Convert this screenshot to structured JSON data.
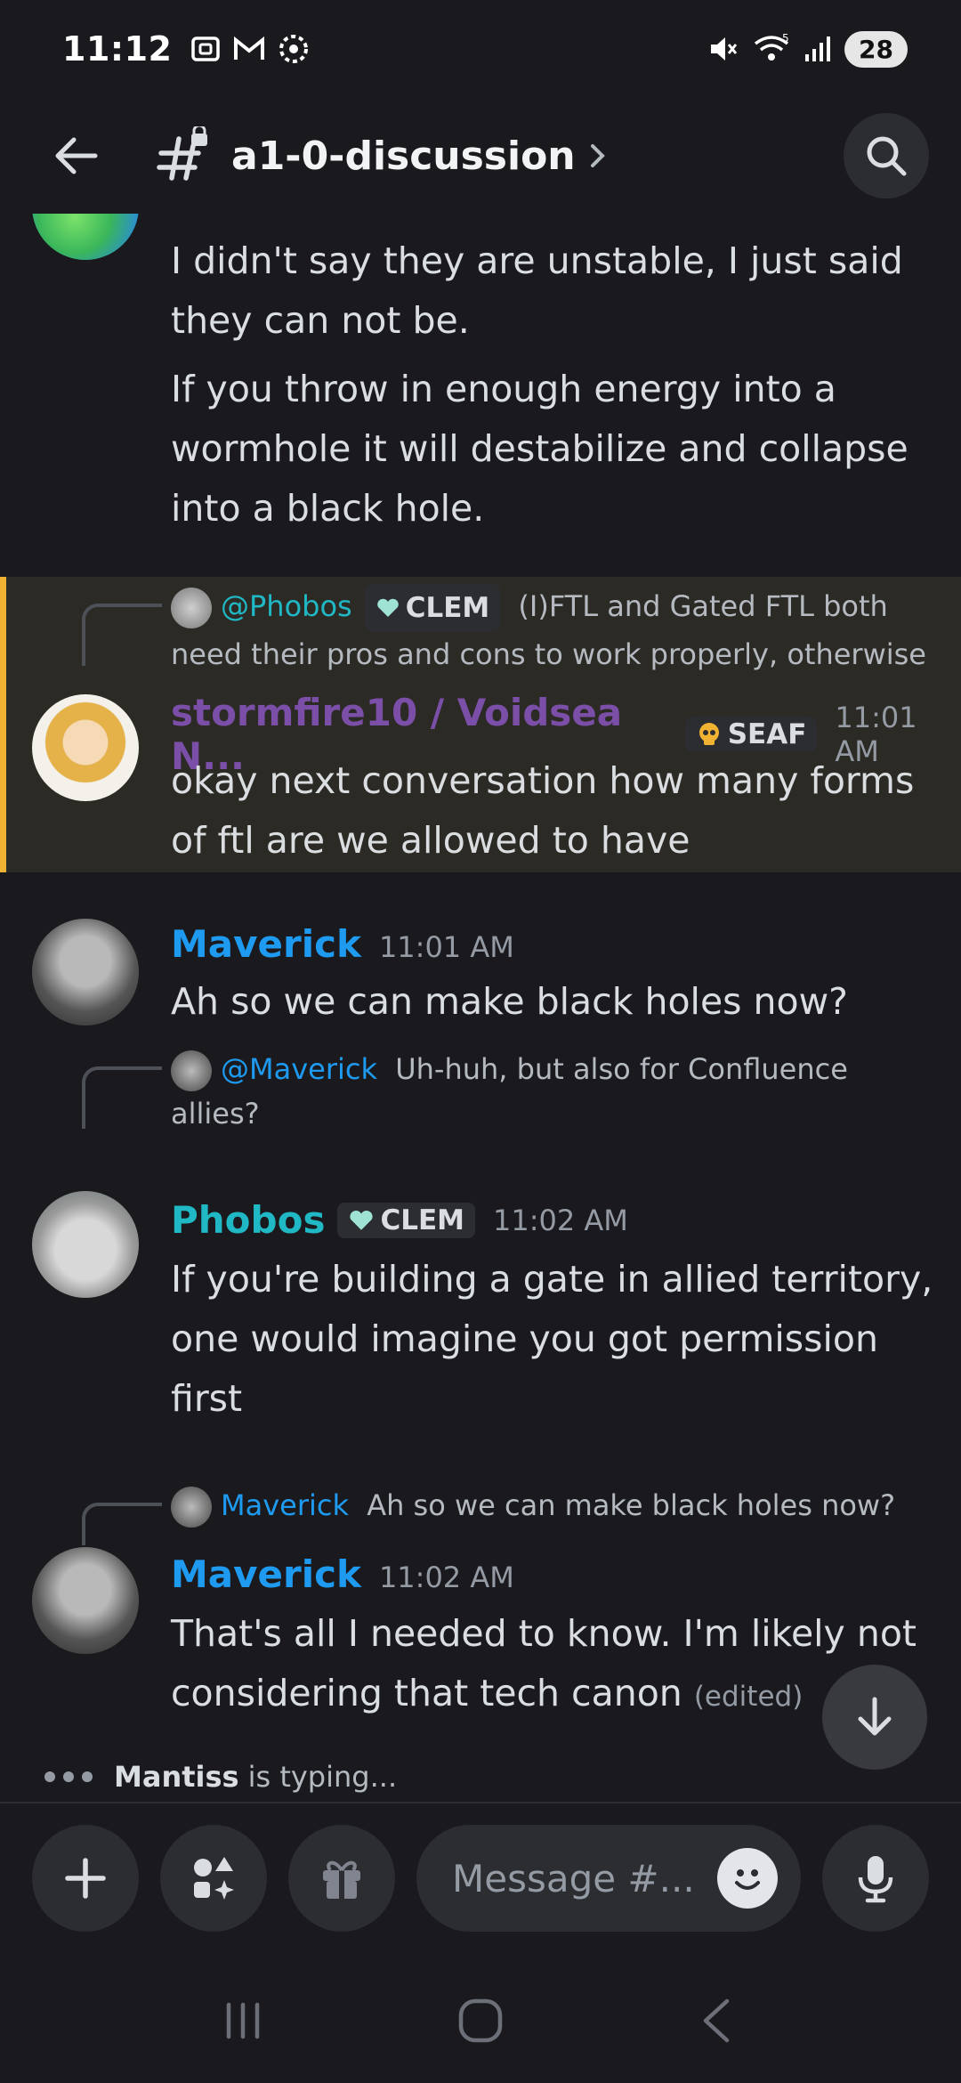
{
  "status": {
    "time": "11:12",
    "battery": "28",
    "signal_label": "5"
  },
  "header": {
    "channel": "a1-0-discussion"
  },
  "messages": {
    "m1": {
      "line1": "I didn't say they are unstable, I just said",
      "line2": "they can not be.",
      "line3": "If you throw in enough energy into a",
      "line4": "wormhole it will destabilize and collapse",
      "line5": "into a black hole."
    },
    "m2": {
      "reply_name": "@Phobos",
      "reply_tag": "CLEM",
      "reply_text1": "(I)FTL and Gated FTL both",
      "reply_text2": "need their pros and cons to work properly, otherwise",
      "name": "stormfire10 / Voidsea N...",
      "tag": "SEAF",
      "time": "11:01 AM",
      "line1": "okay next conversation how many forms",
      "line2": "of ftl are we allowed to have"
    },
    "m3": {
      "name": "Maverick",
      "time": "11:01 AM",
      "line1": "Ah so we can make black holes now?"
    },
    "m4": {
      "reply_name": "@Maverick",
      "reply_text1": "Uh-huh, but also for Confluence",
      "reply_text2": "allies?",
      "name": "Phobos",
      "tag": "CLEM",
      "time": "11:02 AM",
      "line1": "If you're building a gate in allied territory,",
      "line2": "one would imagine you got permission",
      "line3": "first"
    },
    "m5": {
      "reply_name": "Maverick",
      "reply_text1": "Ah so we can make black holes now?",
      "name": "Maverick",
      "time": "11:02 AM",
      "line1": "That's all I needed to know. I'm likely not",
      "line2": "considering that tech canon",
      "edited": "(edited)"
    }
  },
  "typing": {
    "user": "Mantiss",
    "text": "is typing..."
  },
  "composer": {
    "placeholder": "Message #..."
  },
  "colors": {
    "accent_blue": "#1e9bf0",
    "teal": "#1fb8c4",
    "purple": "#7b4fa8",
    "highlight_bar": "#f0b232"
  }
}
